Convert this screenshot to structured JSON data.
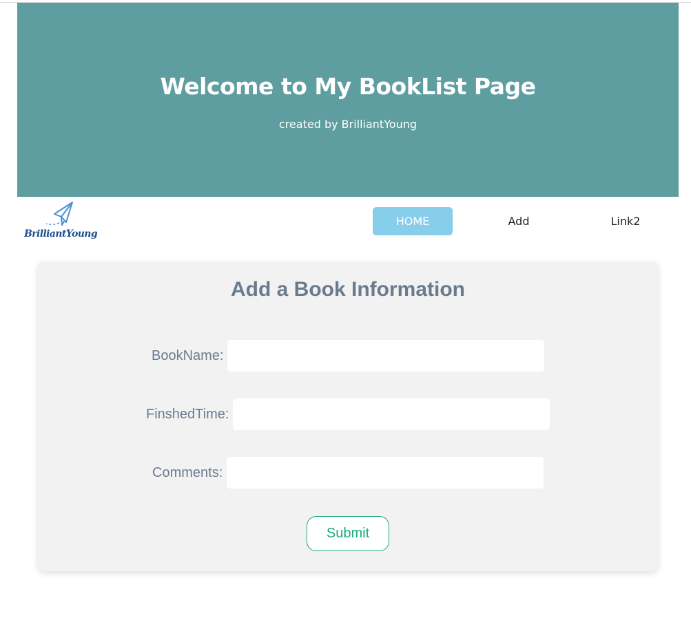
{
  "hero": {
    "title": "Welcome to My BookList Page",
    "subtitle": "created by BrilliantYoung",
    "background_color": "#5f9ea0"
  },
  "navbar": {
    "logo": {
      "icon": "paper-plane-icon",
      "text": "BrilliantYoung"
    },
    "items": [
      {
        "label": "HOME",
        "active": true
      },
      {
        "label": "Add",
        "active": false
      },
      {
        "label": "Link2",
        "active": false
      }
    ],
    "active_color": "#87ceeb"
  },
  "form": {
    "title": "Add a Book Information",
    "fields": [
      {
        "label": "BookName:",
        "value": ""
      },
      {
        "label": "FinshedTime:",
        "value": ""
      },
      {
        "label": "Comments:",
        "value": ""
      }
    ],
    "submit_label": "Submit",
    "submit_color": "#1aaa7a"
  }
}
